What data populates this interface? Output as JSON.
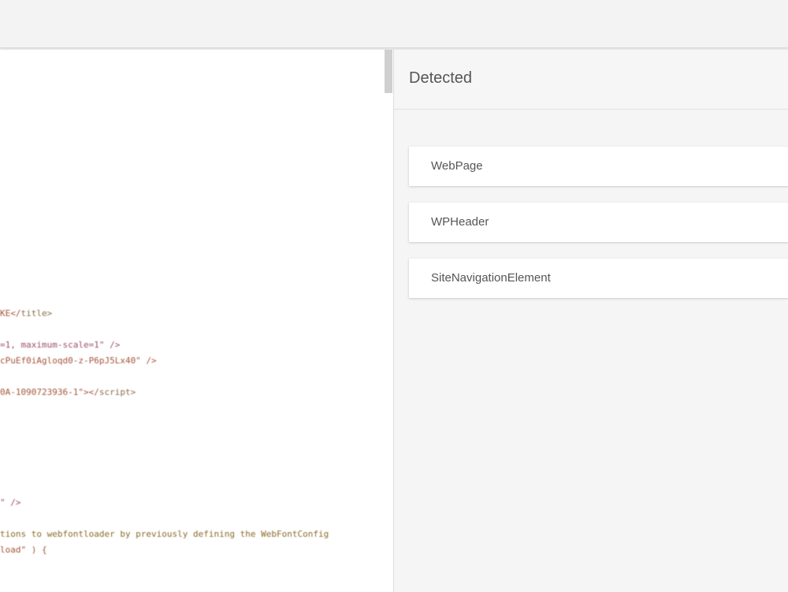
{
  "results": {
    "title": "Detected",
    "items": [
      {
        "label": "WebPage"
      },
      {
        "label": "WPHeader"
      },
      {
        "label": "SiteNavigationElement"
      }
    ]
  },
  "code": {
    "lines": [
      {
        "a": "KE</",
        "b": "title",
        "c": ">"
      },
      {
        "a": "=1, maximum-scale=1\" />",
        "b": "",
        "c": ""
      },
      {
        "a": "cPuEf0iAgloqd0-z-P6pJ5Lx40\" />",
        "b": "",
        "c": ""
      },
      {
        "a": "0A-1090723936-1\"></",
        "b": "script",
        "c": ">"
      },
      {
        "a": "\" />",
        "b": "",
        "c": ""
      },
      {
        "a": "tions to webfontloader by previously defining the WebFontConfig",
        "b": "",
        "c": ""
      },
      {
        "a": "load\" ) {",
        "b": "",
        "c": ""
      }
    ]
  }
}
